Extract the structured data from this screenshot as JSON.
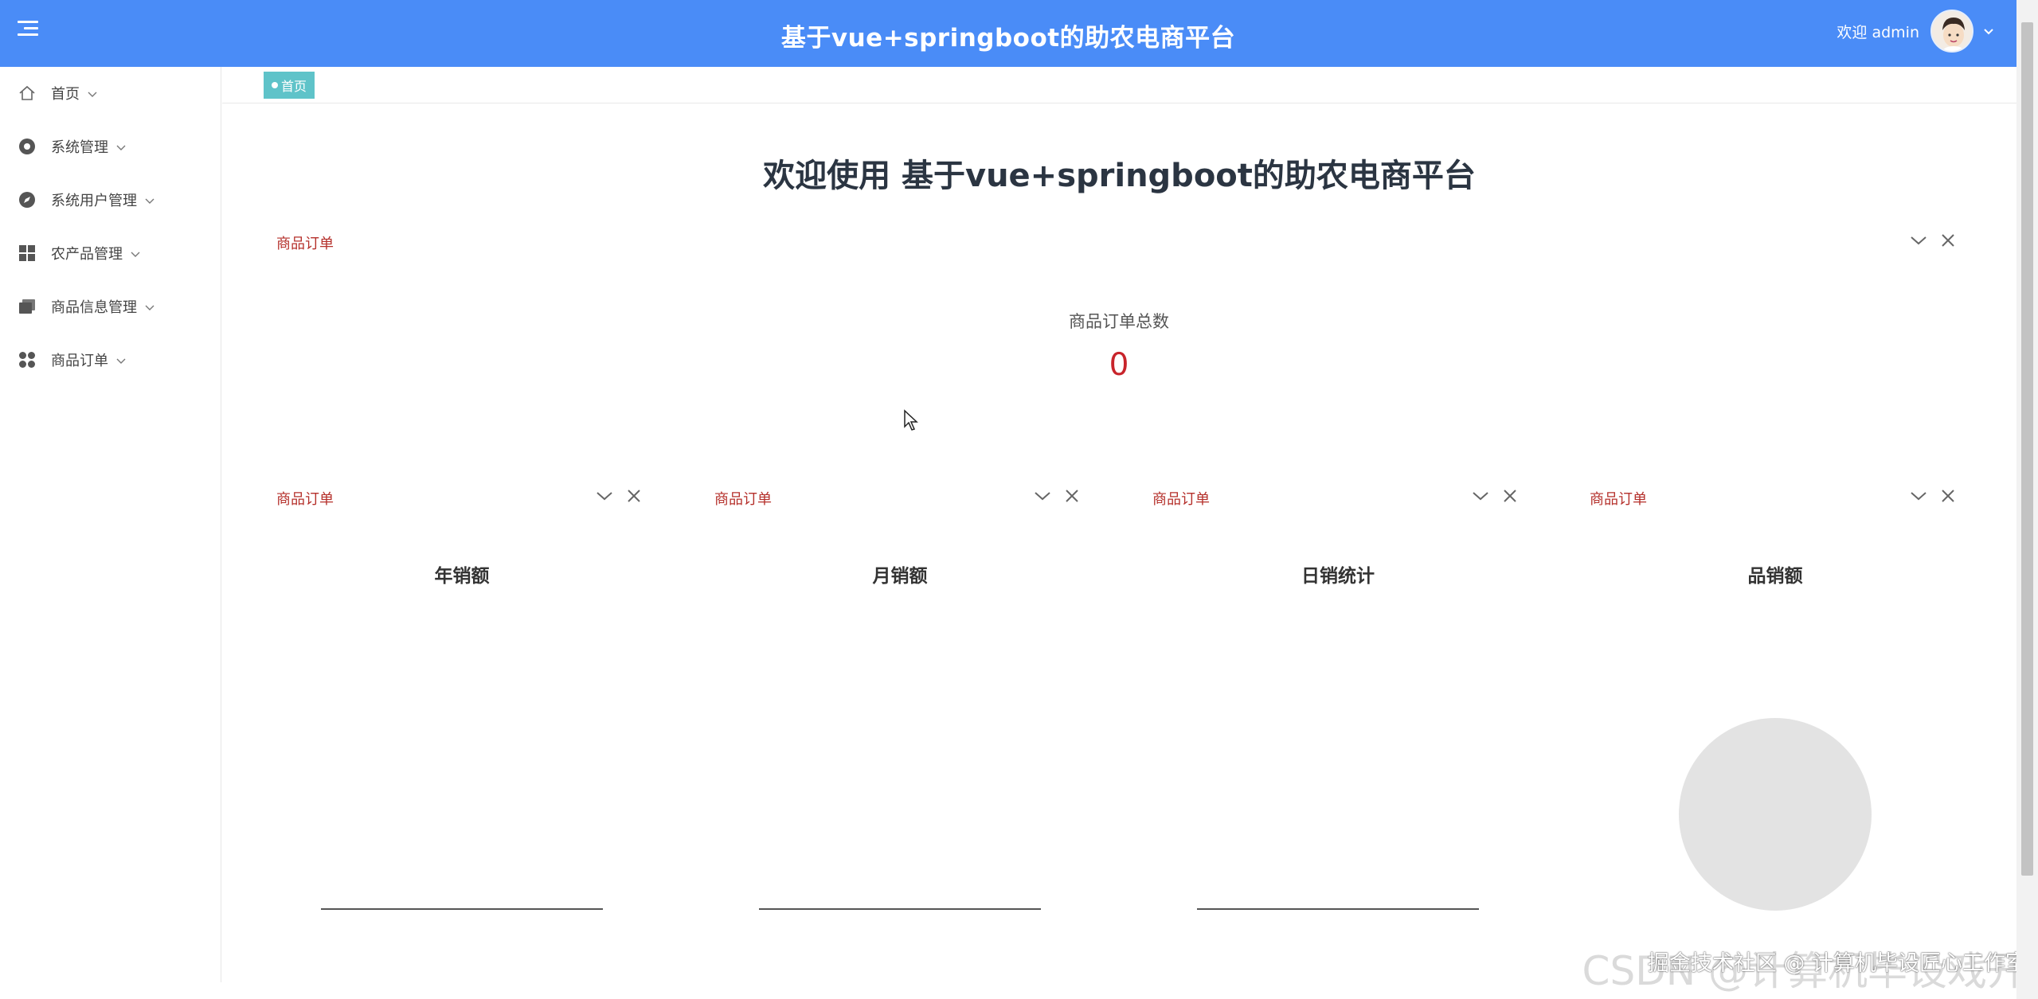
{
  "header": {
    "title": "基于vue+springboot的助农电商平台",
    "greeting": "欢迎 admin"
  },
  "sidebar": {
    "items": [
      {
        "label": "首页",
        "icon": "home-icon"
      },
      {
        "label": "系统管理",
        "icon": "settings-circle-icon"
      },
      {
        "label": "系统用户管理",
        "icon": "compass-icon"
      },
      {
        "label": "农产品管理",
        "icon": "grid-icon"
      },
      {
        "label": "商品信息管理",
        "icon": "folders-icon"
      },
      {
        "label": "商品订单",
        "icon": "apps-icon"
      }
    ]
  },
  "tags": {
    "active": "首页"
  },
  "main": {
    "welcome": "欢迎使用 基于vue+springboot的助农电商平台",
    "total_card": {
      "label": "商品订单",
      "title": "商品订单总数",
      "value": "0"
    },
    "chart_cards": [
      {
        "label": "商品订单",
        "title": "年销额"
      },
      {
        "label": "商品订单",
        "title": "月销额"
      },
      {
        "label": "商品订单",
        "title": "日销统计"
      },
      {
        "label": "商品订单",
        "title": "品销额"
      }
    ]
  },
  "watermark": {
    "text": "掘金技术社区 @ 计算机毕设匠心工作室",
    "faint": "CSDN @计算机毕设戏开"
  },
  "colors": {
    "header_bg": "#4a8cf7",
    "tag_bg": "#5fc3c9",
    "card_label": "#b5302b",
    "total_value": "#c8242b"
  }
}
